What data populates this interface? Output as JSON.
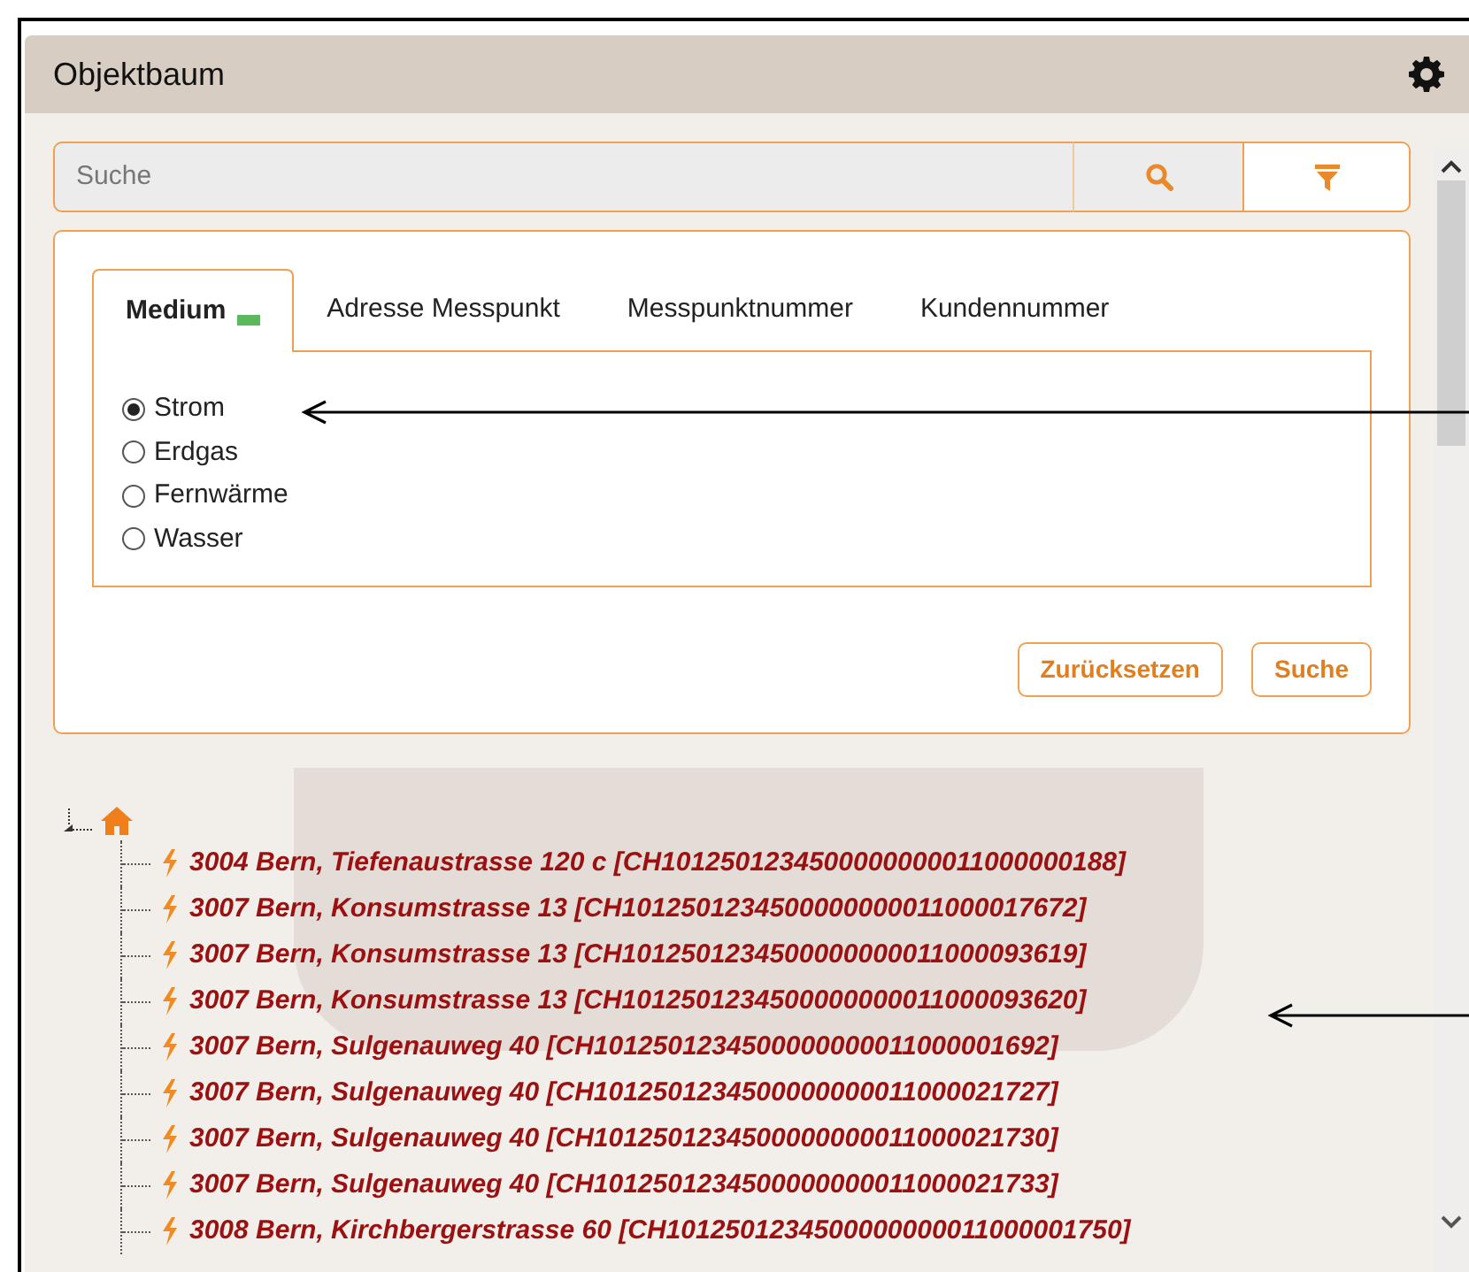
{
  "panel": {
    "title": "Objektbaum"
  },
  "search": {
    "placeholder": "Suche"
  },
  "tabs": [
    {
      "label": "Medium",
      "selected": true
    },
    {
      "label": "Adresse Messpunkt",
      "selected": false
    },
    {
      "label": "Messpunktnummer",
      "selected": false
    },
    {
      "label": "Kundennummer",
      "selected": false
    }
  ],
  "options": [
    {
      "label": "Strom",
      "selected": true
    },
    {
      "label": "Erdgas",
      "selected": false
    },
    {
      "label": "Fernwärme",
      "selected": false
    },
    {
      "label": "Wasser",
      "selected": false
    }
  ],
  "buttons": [
    "Zurücksetzen",
    "Suche"
  ],
  "tree": {
    "children": [
      {
        "label": "3004 Bern, Tiefenaustrasse 120 c [CH1012501234500000000011000000188]"
      },
      {
        "label": "3007 Bern, Konsumstrasse 13 [CH1012501234500000000011000017672]"
      },
      {
        "label": "3007 Bern, Konsumstrasse 13 [CH1012501234500000000011000093619]"
      },
      {
        "label": "3007 Bern, Konsumstrasse 13 [CH1012501234500000000011000093620]"
      },
      {
        "label": "3007 Bern, Sulgenauweg 40 [CH1012501234500000000011000001692]"
      },
      {
        "label": "3007 Bern, Sulgenauweg 40 [CH1012501234500000000011000021727]"
      },
      {
        "label": "3007 Bern, Sulgenauweg 40 [CH1012501234500000000011000021730]"
      },
      {
        "label": "3007 Bern, Sulgenauweg 40 [CH1012501234500000000011000021733]"
      },
      {
        "label": "3008 Bern, Kirchbergerstrasse 60 [CH1012501234500000000011000001750]"
      }
    ]
  }
}
